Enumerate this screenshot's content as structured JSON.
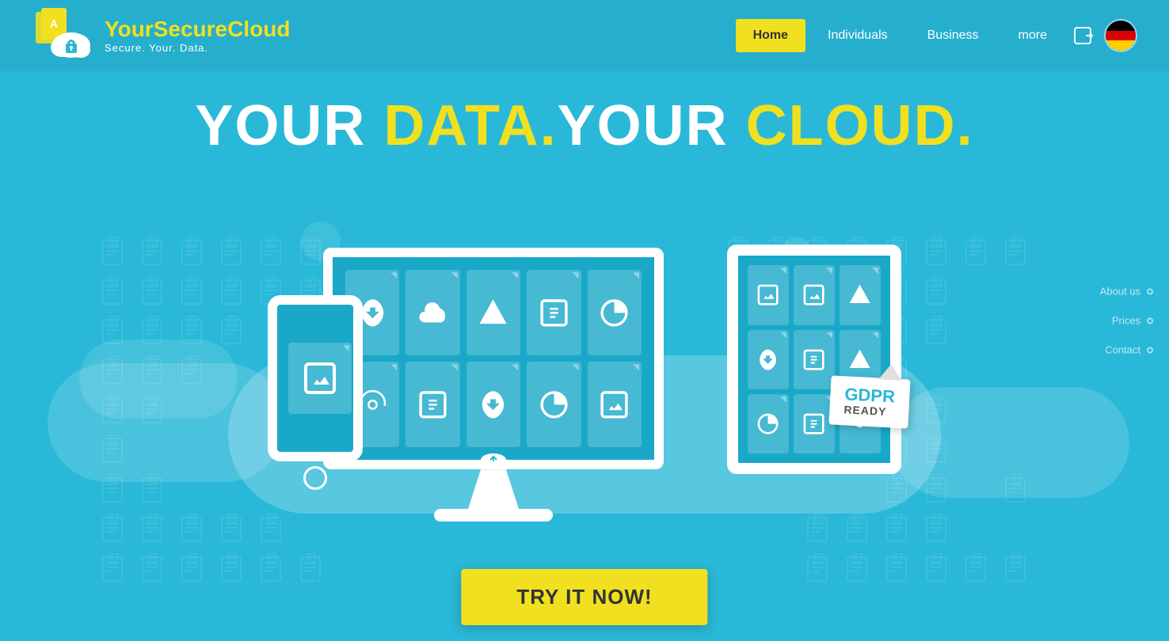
{
  "site": {
    "name_part1": "Your",
    "name_part2": "Secure",
    "name_part3": "Cloud",
    "tagline": "Secure. Your. Data."
  },
  "nav": {
    "home": "Home",
    "individuals": "Individuals",
    "business": "Business",
    "more": "more"
  },
  "side_nav": {
    "about": "About us",
    "prices": "Prices",
    "contact": "Contact"
  },
  "hero": {
    "headline_white1": "YOUR ",
    "headline_yellow1": "DATA.",
    "headline_white2": "YOUR ",
    "headline_yellow2": "CLOUD."
  },
  "gdpr": {
    "title": "GDPR",
    "subtitle": "READY"
  },
  "cta": {
    "button": "TRY IT NOW!"
  }
}
